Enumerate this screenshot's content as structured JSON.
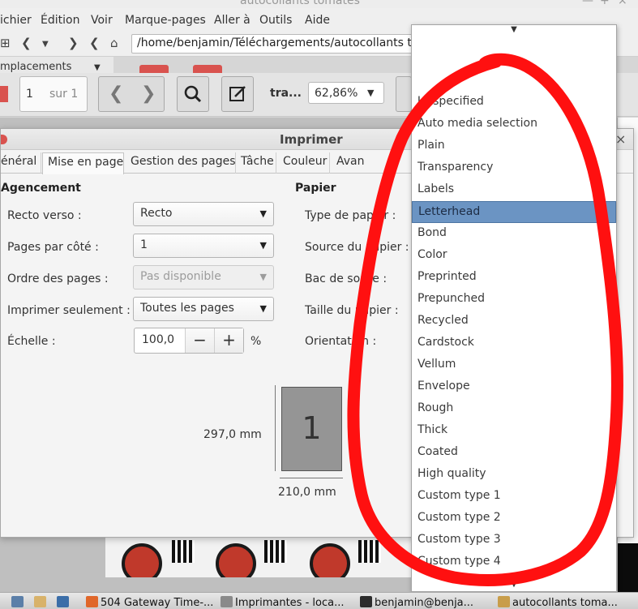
{
  "window": {
    "title": "autocollants tomates"
  },
  "menubar": [
    "ichier",
    "Édition",
    "Voir",
    "Marque-pages",
    "Aller à",
    "Outils",
    "Aide"
  ],
  "address_bar": {
    "url": "/home/benjamin/Téléchargements/autocollants to"
  },
  "sidebar": {
    "header": "mplacements"
  },
  "pdf_toolbar": {
    "page_current": "1",
    "page_total_label": "sur 1",
    "tool_label": "tra...",
    "zoom": "62,86%"
  },
  "print_dialog": {
    "title": "Imprimer",
    "tabs": [
      {
        "label": "énéral"
      },
      {
        "label": "Mise en page"
      },
      {
        "label": "Gestion des pages"
      },
      {
        "label": "Tâche"
      },
      {
        "label": "Couleur"
      },
      {
        "label": "Avan"
      }
    ],
    "active_tab": "Mise en page",
    "layout_section": {
      "title": "Agencement",
      "duplex_label": "Recto verso :",
      "duplex_value": "Recto",
      "pages_per_side_label": "Pages par côté :",
      "pages_per_side_value": "1",
      "page_order_label": "Ordre des pages :",
      "page_order_value": "Pas disponible",
      "print_only_label": "Imprimer seulement :",
      "print_only_value": "Toutes les pages",
      "scale_label": "Échelle :",
      "scale_value": "100,0",
      "scale_unit": "%"
    },
    "paper_section": {
      "title": "Papier",
      "paper_type_label": "Type de papier :",
      "paper_source_label": "Source du papier :",
      "output_tray_label": "Bac de sortie :",
      "paper_size_label": "Taille du papier :",
      "orientation_label": "Orientation :"
    },
    "preview": {
      "page_number": "1",
      "height_label": "297,0 mm",
      "width_label": "210,0 mm"
    }
  },
  "paper_type_dropdown": {
    "selected": "Letterhead",
    "options": [
      "Unspecified",
      "Auto media selection",
      "Plain",
      "Transparency",
      "Labels",
      "Letterhead",
      "Bond",
      "Color",
      "Preprinted",
      "Prepunched",
      "Recycled",
      "Cardstock",
      "Vellum",
      "Envelope",
      "Rough",
      "Thick",
      "Coated",
      "High quality",
      "Custom type 1",
      "Custom type 2",
      "Custom type 3",
      "Custom type 4"
    ]
  },
  "annotation": {
    "color": "#ff1010"
  },
  "taskbar": {
    "items": [
      {
        "label": "504 Gateway Time-..."
      },
      {
        "label": "Imprimantes - loca..."
      },
      {
        "label": "benjamin@benja..."
      },
      {
        "label": "autocollants toma..."
      }
    ]
  }
}
